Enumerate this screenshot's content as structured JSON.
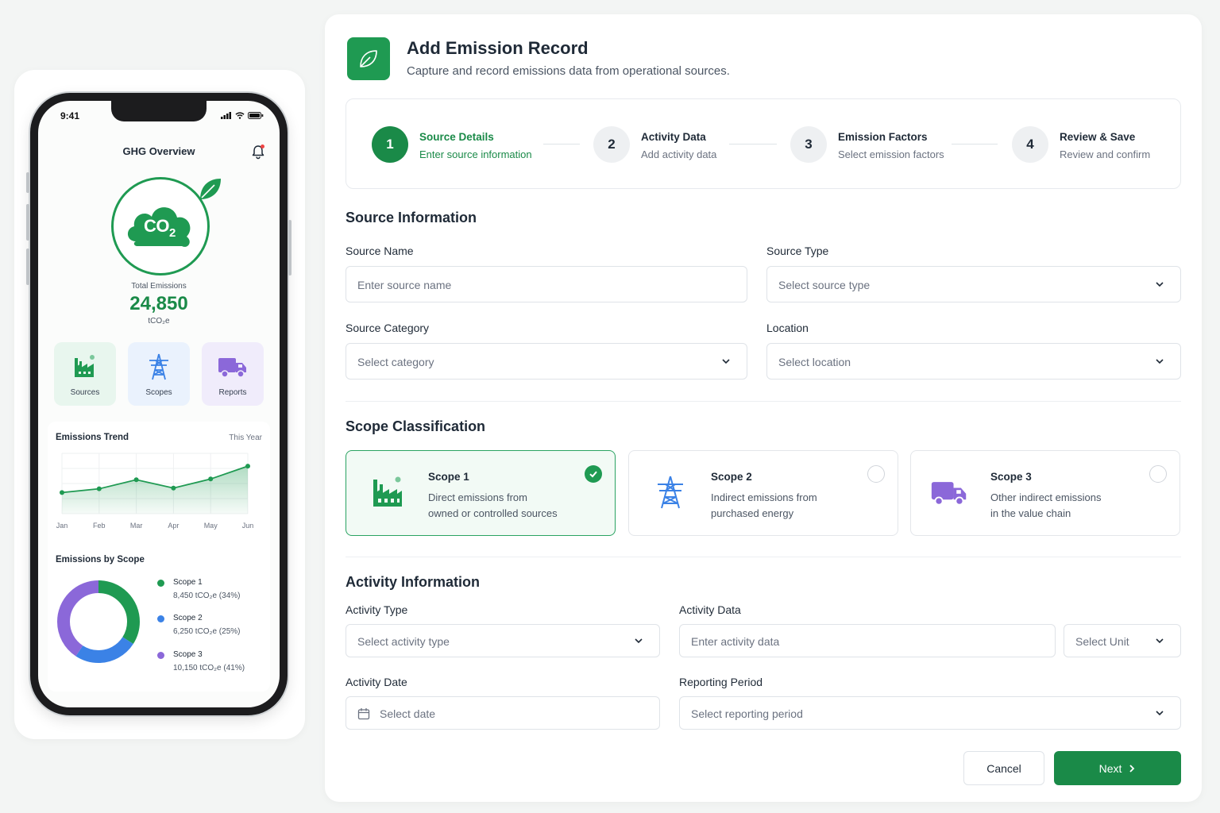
{
  "phone": {
    "status_time": "9:41",
    "title": "GHG Overview",
    "co2_label": "CO",
    "co2_sub": "2",
    "total_label": "Total Emissions",
    "total_value": "24,850",
    "total_unit": "tCO₂e",
    "tiles": [
      {
        "label": "Sources",
        "icon": "factory-icon",
        "bg": "#e8f6ee"
      },
      {
        "label": "Scopes",
        "icon": "power-tower-icon",
        "bg": "#eaf2fd"
      },
      {
        "label": "Reports",
        "icon": "truck-icon",
        "bg": "#f0ecfb"
      }
    ],
    "trend": {
      "title": "Emissions Trend",
      "period": "This Year"
    },
    "scope_title": "Emissions by Scope",
    "legend": [
      {
        "name": "Scope 1",
        "value": "8,450 tCO₂e   (34%)",
        "color": "#1f9a52"
      },
      {
        "name": "Scope 2",
        "value": "6,250 tCO₂e   (25%)",
        "color": "#3b82e6"
      },
      {
        "name": "Scope 3",
        "value": "10,150 tCO₂e   (41%)",
        "color": "#8b68d9"
      }
    ]
  },
  "chart_data": [
    {
      "type": "area",
      "title": "Emissions Trend",
      "categories": [
        "Jan",
        "Feb",
        "Mar",
        "Apr",
        "May",
        "Jun"
      ],
      "values": [
        28,
        33,
        45,
        34,
        46,
        63
      ],
      "ylim": [
        0,
        80
      ],
      "grid": true,
      "color": "#1f9a52"
    },
    {
      "type": "pie",
      "title": "Emissions by Scope",
      "categories": [
        "Scope 1",
        "Scope 2",
        "Scope 3"
      ],
      "values": [
        8450,
        6250,
        10150
      ],
      "percent": [
        34,
        25,
        41
      ],
      "colors": [
        "#1f9a52",
        "#3b82e6",
        "#8b68d9"
      ],
      "donut": true
    }
  ],
  "header": {
    "title": "Add Emission Record",
    "subtitle": "Capture and record emissions data from operational sources."
  },
  "steps": [
    {
      "num": "1",
      "title": "Source Details",
      "sub": "Enter source information",
      "active": true
    },
    {
      "num": "2",
      "title": "Activity Data",
      "sub": "Add activity data",
      "active": false
    },
    {
      "num": "3",
      "title": "Emission Factors",
      "sub": "Select emission factors",
      "active": false
    },
    {
      "num": "4",
      "title": "Review & Save",
      "sub": "Review and confirm",
      "active": false
    }
  ],
  "source": {
    "section": "Source Information",
    "name_label": "Source Name",
    "name_ph": "Enter source name",
    "type_label": "Source Type",
    "type_ph": "Select source type",
    "category_label": "Source Category",
    "category_ph": "Select category",
    "location_label": "Location",
    "location_ph": "Select location"
  },
  "scope": {
    "section": "Scope Classification",
    "cards": [
      {
        "title": "Scope 1",
        "d1": "Direct emissions from",
        "d2": "owned or controlled sources",
        "selected": true
      },
      {
        "title": "Scope 2",
        "d1": "Indirect emissions from",
        "d2": "purchased energy",
        "selected": false
      },
      {
        "title": "Scope 3",
        "d1": "Other indirect emissions",
        "d2": "in the value chain",
        "selected": false
      }
    ]
  },
  "activity": {
    "section": "Activity Information",
    "type_label": "Activity Type",
    "type_ph": "Select activity type",
    "data_label": "Activity Data",
    "data_ph": "Enter activity data",
    "unit_ph": "Select Unit",
    "date_label": "Activity Date",
    "date_ph": "Select date",
    "period_label": "Reporting Period",
    "period_ph": "Select reporting period"
  },
  "actions": {
    "cancel": "Cancel",
    "next": "Next"
  },
  "colors": {
    "brand": "#1a8a48",
    "scope2": "#3b82e6",
    "scope3": "#8b68d9"
  }
}
